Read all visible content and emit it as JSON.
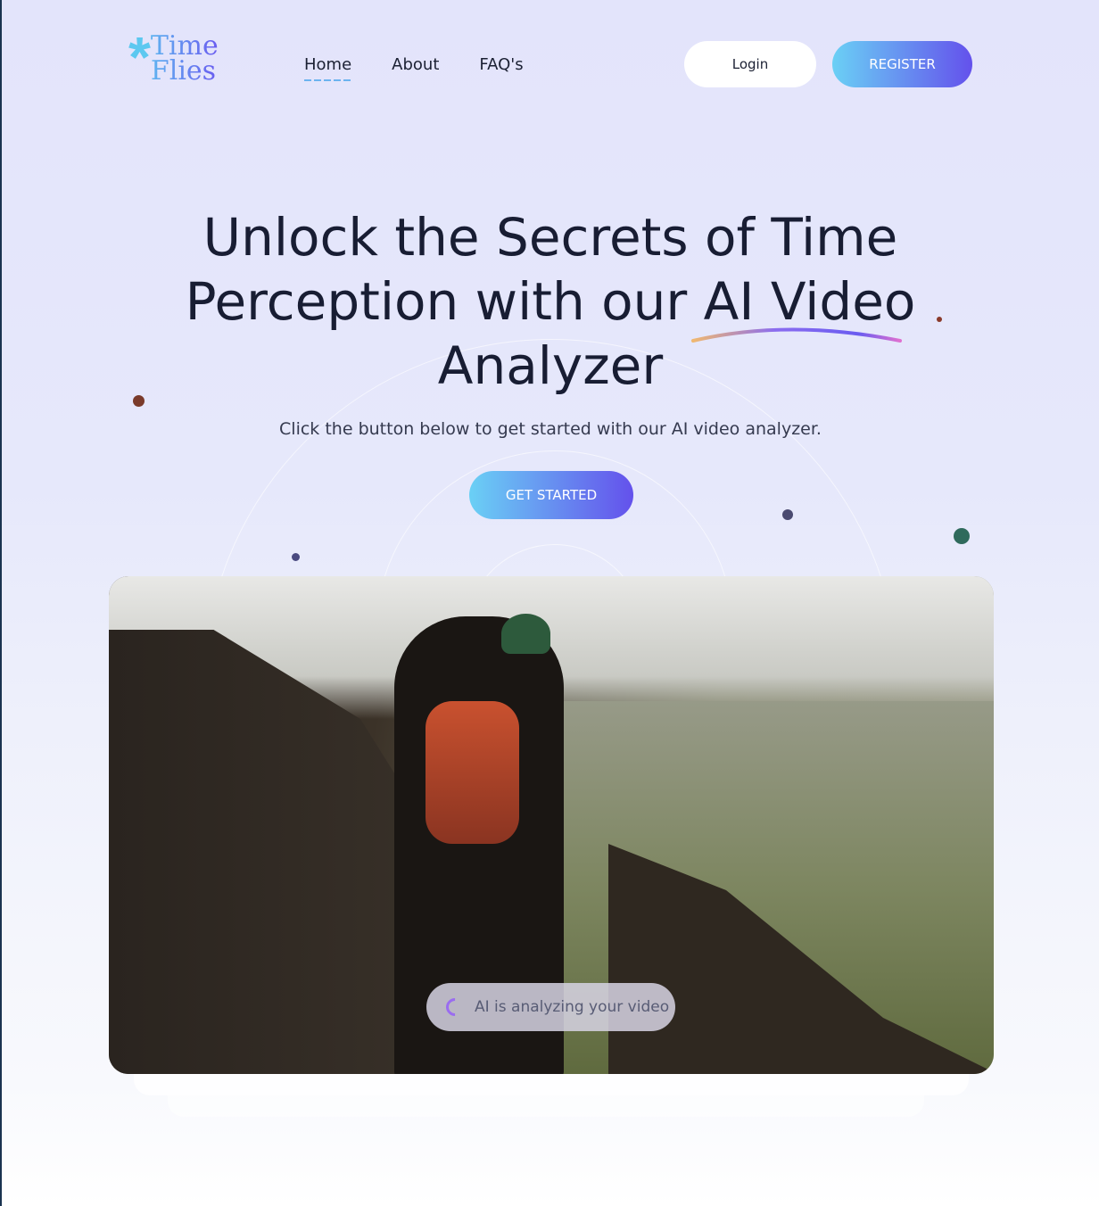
{
  "logo": {
    "line1": "Time",
    "line2": "Flies"
  },
  "nav": {
    "items": [
      {
        "label": "Home",
        "active": true
      },
      {
        "label": "About"
      },
      {
        "label": "FAQ's"
      }
    ],
    "login": "Login",
    "register": "REGISTER"
  },
  "hero": {
    "title_part1": "Unlock the Secrets of Time",
    "title_part2": "Perception with our AI Video",
    "title_part3": "Analyzer",
    "subtitle": "Click the button below to get started with our AI video analyzer.",
    "cta": "GET STARTED"
  },
  "video": {
    "status": "AI is analyzing your video"
  },
  "colors": {
    "accent_start": "#6ad0f5",
    "accent_end": "#6451ec"
  }
}
